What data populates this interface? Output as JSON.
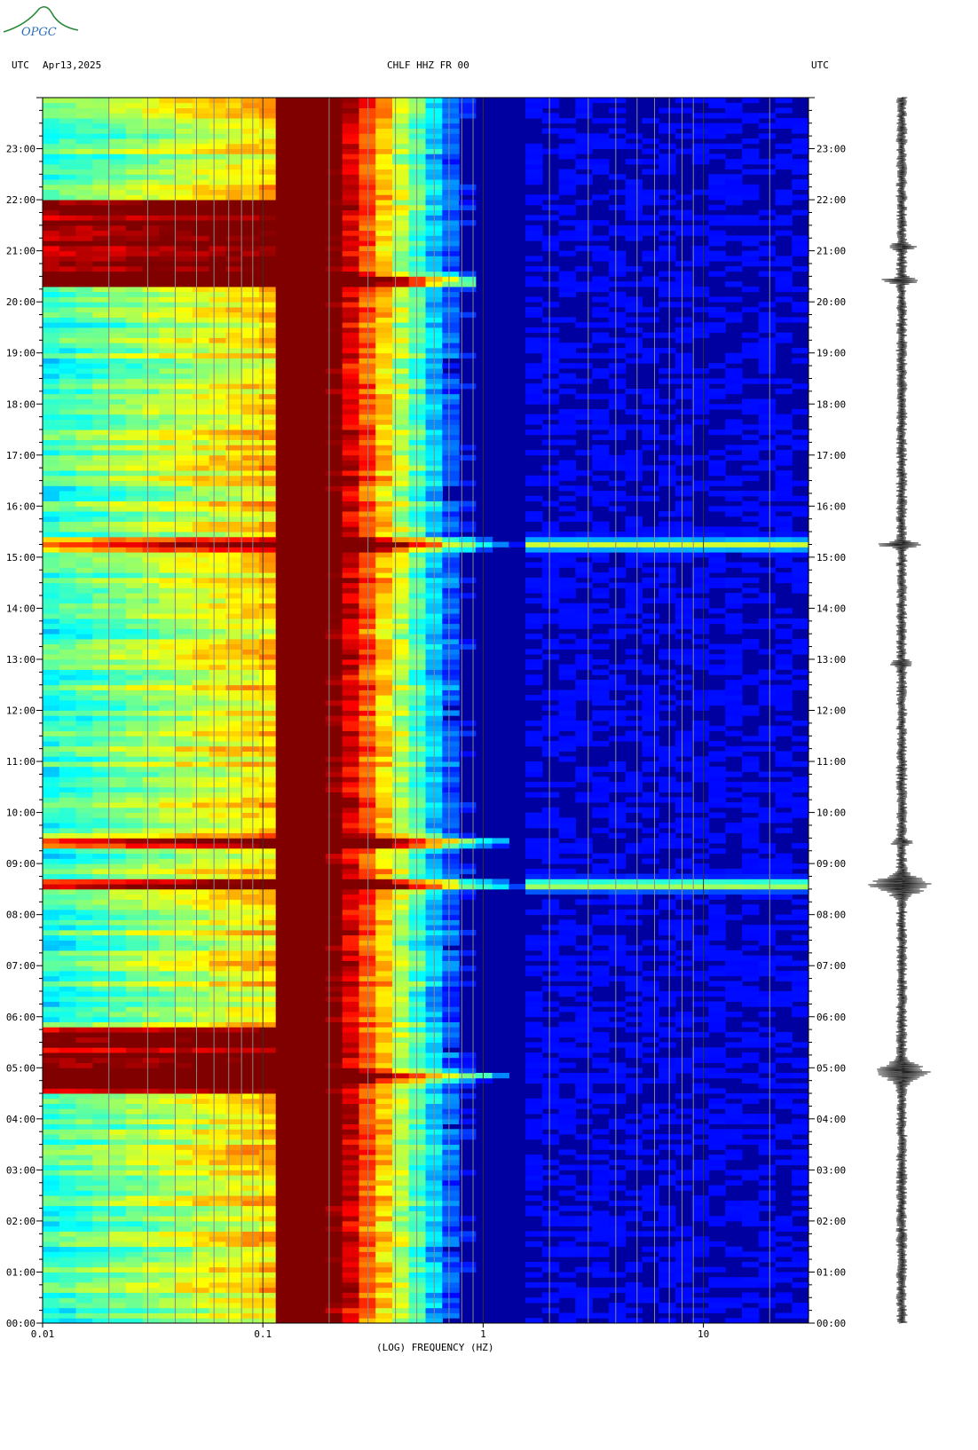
{
  "header": {
    "left_tz": "UTC",
    "date": "Apr13,2025",
    "station": "CHLF HHZ FR 00",
    "right_tz": "UTC"
  },
  "logo": {
    "text": "OPGC"
  },
  "chart_data": {
    "type": "heatmap",
    "title": "CHLF HHZ FR 00",
    "xlabel": "(LOG) FREQUENCY (HZ)",
    "xscale": "log",
    "xlim": [
      0.01,
      30
    ],
    "x_ticks": [
      0.01,
      0.1,
      1,
      10
    ],
    "x_tick_labels": [
      "0.01",
      "0.1",
      "1",
      "10"
    ],
    "ylim_hours": [
      0,
      24
    ],
    "y_tick_labels": [
      "00:00",
      "01:00",
      "02:00",
      "03:00",
      "04:00",
      "05:00",
      "06:00",
      "07:00",
      "08:00",
      "09:00",
      "10:00",
      "11:00",
      "12:00",
      "13:00",
      "14:00",
      "15:00",
      "16:00",
      "17:00",
      "18:00",
      "19:00",
      "20:00",
      "21:00",
      "22:00",
      "23:00"
    ],
    "background_color": "#0000a0",
    "microseism_band_hz": [
      0.12,
      0.2
    ],
    "events": [
      {
        "time": "04:50",
        "max_freq_hz": 1.2
      },
      {
        "time": "09:25",
        "max_freq_hz": 1.5
      },
      {
        "time": "20:25",
        "max_freq_hz": 1.0
      },
      {
        "time": "15:15",
        "max_freq_hz": 30
      },
      {
        "time": "08:35",
        "max_freq_hz": 30
      }
    ],
    "low_freq_high_energy_periods": [
      {
        "start": "04:30",
        "end": "05:45"
      },
      {
        "start": "20:20",
        "end": "22:00"
      }
    ],
    "seismogram_spikes": [
      {
        "time": "04:55",
        "amplitude": 0.9
      },
      {
        "time": "08:35",
        "amplitude": 1.0
      },
      {
        "time": "15:15",
        "amplitude": 0.7
      },
      {
        "time": "20:25",
        "amplitude": 0.6
      },
      {
        "time": "21:05",
        "amplitude": 0.4
      },
      {
        "time": "12:55",
        "amplitude": 0.35
      },
      {
        "time": "09:25",
        "amplitude": 0.3
      }
    ]
  }
}
